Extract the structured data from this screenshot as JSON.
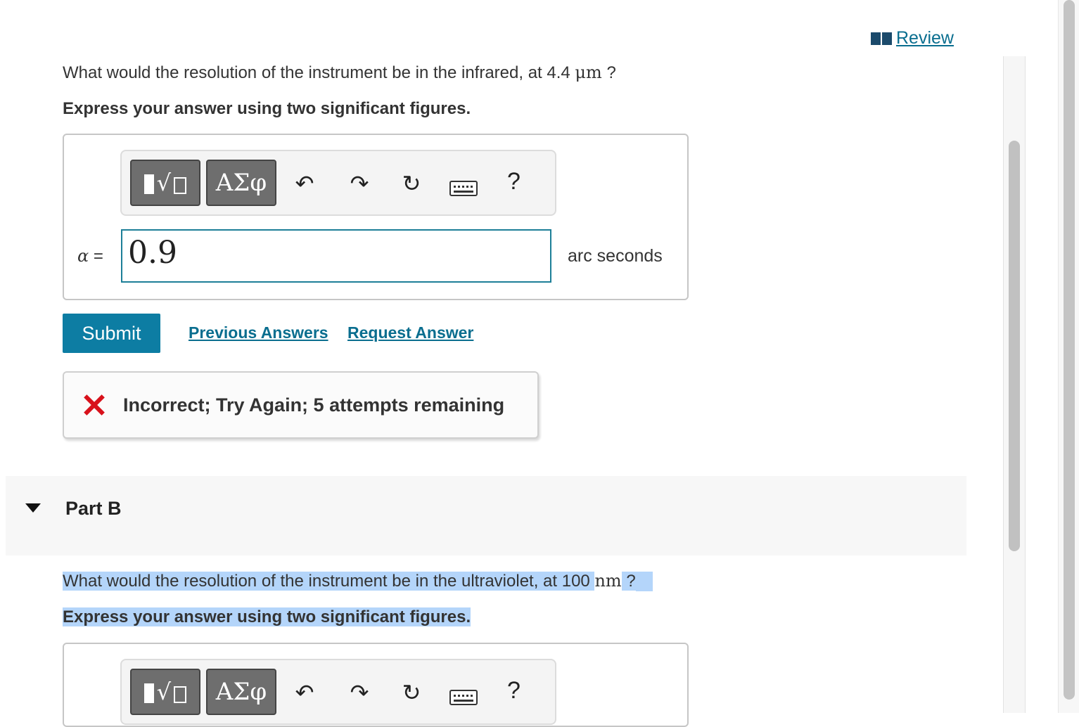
{
  "review": {
    "label": " Review",
    "icon": "book-icon"
  },
  "partA": {
    "question_before": "What would the resolution of the instrument be in the infrared, at 4.4 ",
    "question_unit": "μm",
    "question_after": " ?",
    "instruction": "Express your answer using two significant figures.",
    "toolbar": {
      "template_icon": "templates-icon",
      "greek_label": "ΑΣφ",
      "undo_icon": "↶",
      "redo_icon": "↷",
      "reset_icon": "↻",
      "keyboard_icon": "keyboard-icon",
      "help_label": "?"
    },
    "variable": "α",
    "equals": " =",
    "answer_value": "0.9",
    "units": "arc seconds",
    "submit_label": "Submit",
    "previous_answers_label": "Previous Answers",
    "request_answer_label": "Request Answer",
    "feedback": "Incorrect; Try Again; 5 attempts remaining",
    "feedback_color": "#d8111b"
  },
  "partB": {
    "title": "Part B",
    "question_before": "What would the resolution of the instrument be in the ultraviolet, at 100 ",
    "question_unit": "nm",
    "question_after": " ?",
    "instruction": "Express your answer using two significant figures.",
    "toolbar": {
      "greek_label": "ΑΣφ",
      "undo_icon": "↶",
      "redo_icon": "↷",
      "reset_icon": "↻",
      "help_label": "?"
    }
  },
  "colors": {
    "accent": "#0d7da3",
    "link": "#0a6e8f",
    "selection": "#b4d5fa"
  }
}
